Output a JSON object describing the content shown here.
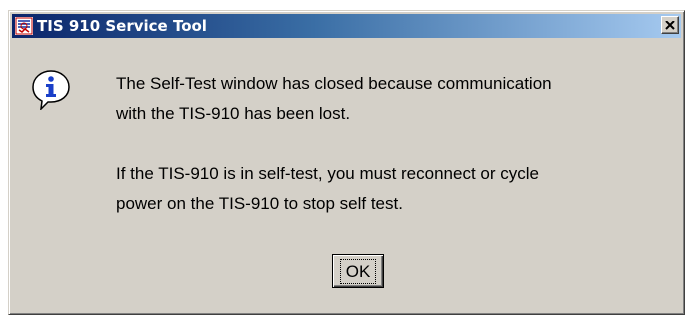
{
  "window": {
    "title": "TIS 910 Service Tool",
    "title_icon": "app-icon",
    "close_glyph": "×"
  },
  "dialog": {
    "icon": "info-icon",
    "message_line_1": "The Self-Test window has closed because communication",
    "message_line_2": "with the TIS-910 has been lost.",
    "message_line_3": "If the TIS-910 is in self-test, you must reconnect or cycle",
    "message_line_4": "power on the TIS-910 to stop self test.",
    "ok_label": "OK"
  },
  "colors": {
    "titlebar_start": "#0a246a",
    "titlebar_end": "#a6caf0",
    "face": "#d4d0c8",
    "info_blue": "#1a3fc8"
  }
}
